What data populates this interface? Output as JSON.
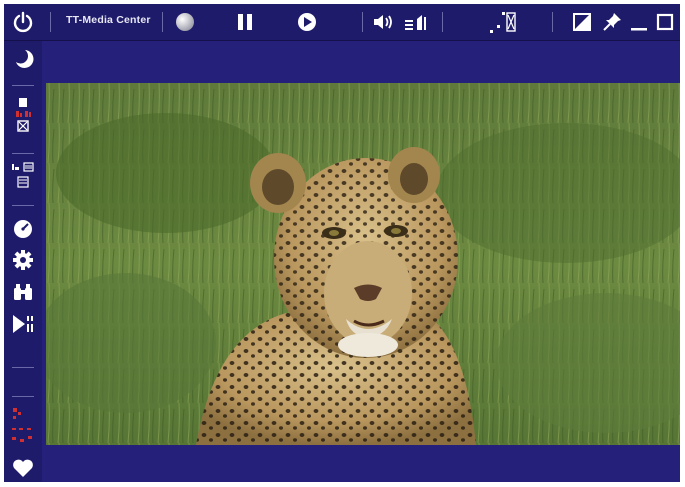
{
  "app": {
    "title": "TT-Media Center"
  },
  "colors": {
    "frame": "#1f1b6b",
    "icon": "#ffffff",
    "accent_red": "#d03030"
  },
  "toolbar": {
    "icons": [
      "power-icon",
      "record-icon",
      "pause-icon",
      "play-icon",
      "volume-icon",
      "audio-settings-icon",
      "fullscreen-icon",
      "aspect-ratio-icon",
      "pin-icon",
      "minimize-icon",
      "maximize-icon"
    ]
  },
  "sidebar": {
    "icons": [
      "sleep-moon-icon",
      "channel-list-icon",
      "recorder-icon",
      "teletext-icon",
      "epg-icon",
      "clock-icon",
      "settings-gear-icon",
      "search-binoculars-icon",
      "timeshift-icon",
      "favorites-heart-icon"
    ]
  },
  "video": {
    "content": "leopard-in-grass"
  }
}
